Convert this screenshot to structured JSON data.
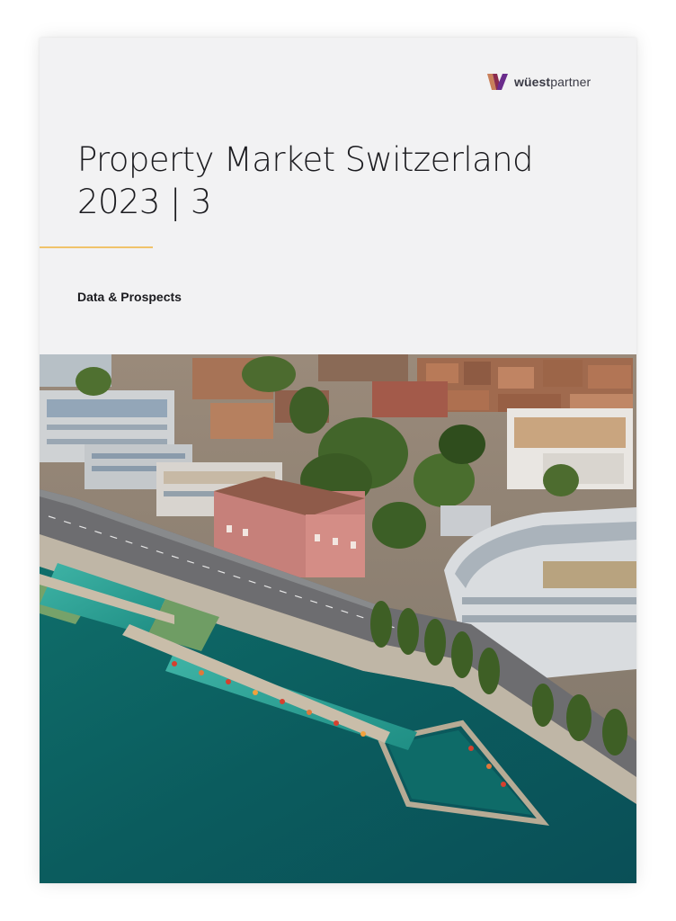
{
  "brand": {
    "name_bold": "wüest",
    "name_light": "partner",
    "logo_colors": [
      "#8a2b4e",
      "#c86a3c",
      "#6a2c8c"
    ]
  },
  "cover": {
    "title_line1": "Property Market Switzerland",
    "title_line2": "2023 | 3",
    "subtitle": "Data & Prospects",
    "accent_color": "#f0c36a"
  },
  "photo": {
    "subject": "aerial-lakeside-town-with-lido"
  }
}
